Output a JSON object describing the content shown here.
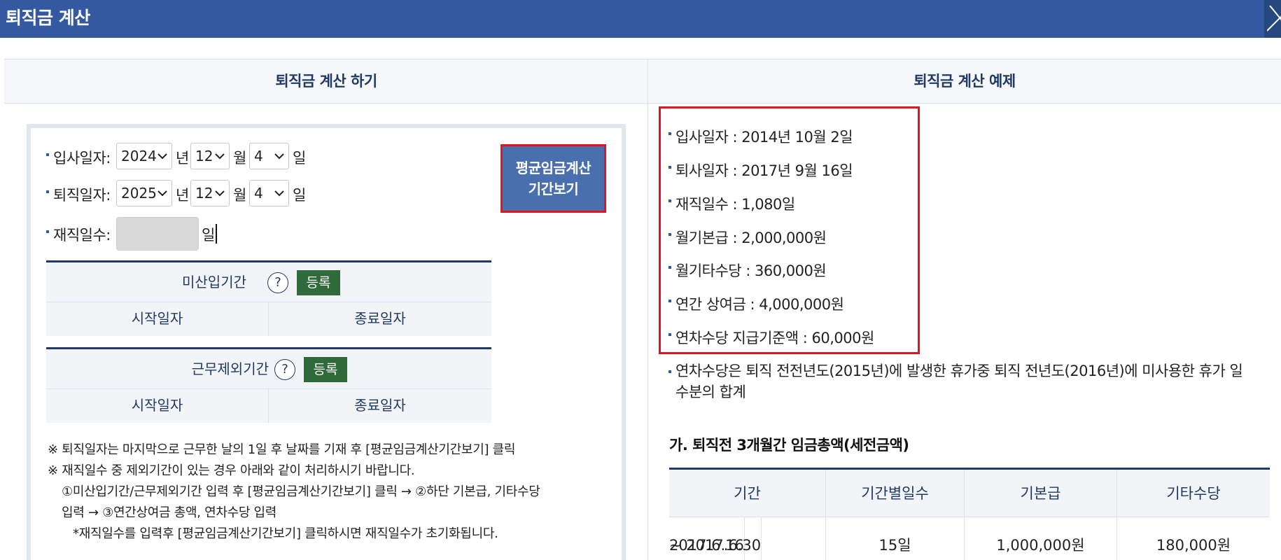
{
  "window": {
    "title": "퇴직금 계산"
  },
  "tabs": [
    {
      "label": "퇴직금 계산 하기"
    },
    {
      "label": "퇴직금 계산 예제"
    }
  ],
  "form": {
    "hire_date": {
      "label": "입사일자:",
      "year": "2024",
      "month": "12",
      "day": "4"
    },
    "leave_date": {
      "label": "퇴직일자:",
      "year": "2025",
      "month": "12",
      "day": "4"
    },
    "units": {
      "year": "년",
      "month": "월",
      "day": "일"
    },
    "service_days": {
      "label": "재직일수:",
      "value": "",
      "unit": "일"
    },
    "avg_wage_button": {
      "line1": "평균임금계산",
      "line2": "기간보기"
    }
  },
  "periods": [
    {
      "title": "미산입기간",
      "help": "?",
      "register": "등록",
      "start": "시작일자",
      "end": "종료일자"
    },
    {
      "title": "근무제외기간",
      "help": "?",
      "register": "등록",
      "start": "시작일자",
      "end": "종료일자"
    }
  ],
  "notes": {
    "line1": "※ 퇴직일자는 마지막으로 근무한 날의 1일 후 날짜를 기재 후 [평균임금계산기간보기] 클릭",
    "line2": "※ 재직일수 중 제외기간이 있는 경우 아래와 같이 처리하시기 바랍니다.",
    "line3": "①미산입기간/근무제외기간 입력 후 [평균임금계산기간보기] 클릭 → ②하단 기본급, 기타수당",
    "line4": "입력 → ③연간상여금 총액, 연차수당 입력",
    "line5": "*재직일수를 입력후 [평균임금계산기간보기] 클릭하시면 재직일수가 초기화됩니다."
  },
  "example": {
    "items": [
      "입사일자 : 2014년 10월 2일",
      "퇴사일자 : 2017년 9월 16일",
      "재직일수 : 1,080일",
      "월기본급 : 2,000,000원",
      "월기타수당 : 360,000원",
      "연간 상여금 : 4,000,000원",
      "연차수당 지급기준액 : 60,000원"
    ],
    "note": "연차수당은 퇴직 전전년도(2015년)에 발생한 휴가중 퇴직 전년도(2016년)에 미사용한 휴가 일수분의 합계",
    "section_title": "가. 퇴직전 3개월간 임금총액(세전금액)",
    "table": {
      "headers": [
        "기간",
        "기간별일수",
        "기본급",
        "기타수당"
      ],
      "rows": [
        {
          "period_line1": "2017.6.16",
          "period_line2": "~ 2017.6.30",
          "days": "15일",
          "base": "1,000,000원",
          "other": "180,000원"
        }
      ]
    }
  }
}
